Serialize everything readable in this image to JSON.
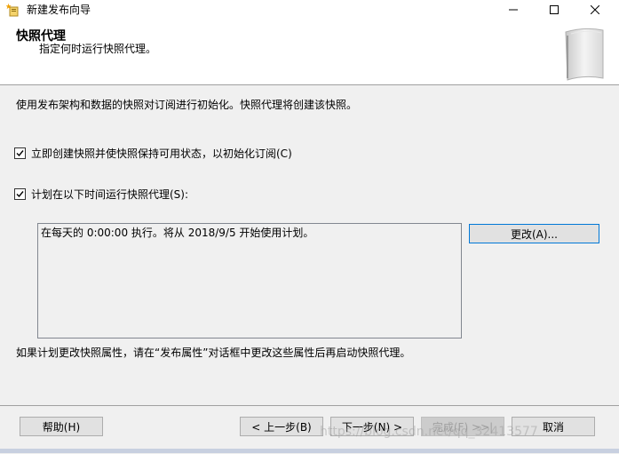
{
  "window": {
    "title": "新建发布向导",
    "minimize_icon": "minimize-icon",
    "maximize_icon": "maximize-icon",
    "close_icon": "close-icon"
  },
  "header": {
    "title": "快照代理",
    "subtitle": "指定何时运行快照代理。"
  },
  "content": {
    "description": "使用发布架构和数据的快照对订阅进行初始化。快照代理将创建该快照。",
    "checkbox_immediate": {
      "label": "立即创建快照并使快照保持可用状态，以初始化订阅(C)",
      "checked": true
    },
    "checkbox_schedule": {
      "label": "计划在以下时间运行快照代理(S):",
      "checked": true
    },
    "schedule_text": "在每天的 0:00:00 执行。将从 2018/9/5 开始使用计划。",
    "change_button": "更改(A)...",
    "footer_note": "如果计划更改快照属性，请在“发布属性”对话框中更改这些属性后再启动快照代理。"
  },
  "buttons": {
    "help": "帮助(H)",
    "back": "< 上一步(B)",
    "next": "下一步(N) >",
    "finish": "完成(F) >>|",
    "cancel": "取消"
  },
  "watermark": "https://blog.csdn.net/qq_32413577",
  "colors": {
    "background": "#f0f0f0",
    "primary_border": "#0078d7",
    "disabled_text": "#a0a0a0"
  }
}
